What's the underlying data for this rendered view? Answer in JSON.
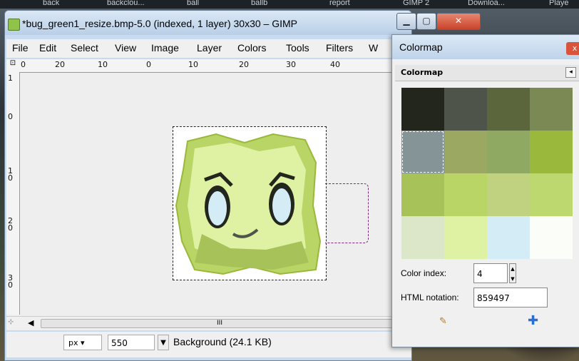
{
  "taskbar": {
    "items": [
      "back",
      "backclou...",
      "ball",
      "ballb",
      "report",
      "GIMP 2",
      "Downloa...",
      "Playe"
    ]
  },
  "gimp": {
    "title": "*bug_green1_resize.bmp-5.0 (indexed, 1 layer) 30x30 – GIMP",
    "menu": [
      "File",
      "Edit",
      "Select",
      "View",
      "Image",
      "Layer",
      "Colors",
      "Tools",
      "Filters",
      "W"
    ],
    "ruler_h": [
      "0",
      "20",
      "10",
      "0",
      "10",
      "20",
      "30",
      "40"
    ],
    "ruler_v": [
      "1",
      "0",
      "1",
      "0",
      "2",
      "0",
      "3",
      "0"
    ],
    "scroll_thumb": "III",
    "status": {
      "unit": "px",
      "zoom": "550",
      "layer": "Background (24.1 KB)"
    }
  },
  "colormap": {
    "window_title": "Colormap",
    "tab_label": "Colormap",
    "swatches": [
      "#23261c",
      "#4e544a",
      "#5b663c",
      "#7b8a55",
      "#859497",
      "#9aa862",
      "#8fa962",
      "#9ab83b",
      "#a8c25a",
      "#b8d565",
      "#c0d27f",
      "#bdd86e",
      "#dce7c9",
      "#dff1a3",
      "#d3ecf6",
      "#fbfdf8"
    ],
    "selected_index": 4,
    "color_index_label": "Color index:",
    "color_index_value": "4",
    "html_label": "HTML notation:",
    "html_value": "859497"
  },
  "colors": {
    "accent_close": "#d9543b",
    "bug_light": "#dff1a3",
    "bug_mid": "#b8d565",
    "bug_dark": "#8fa962"
  }
}
